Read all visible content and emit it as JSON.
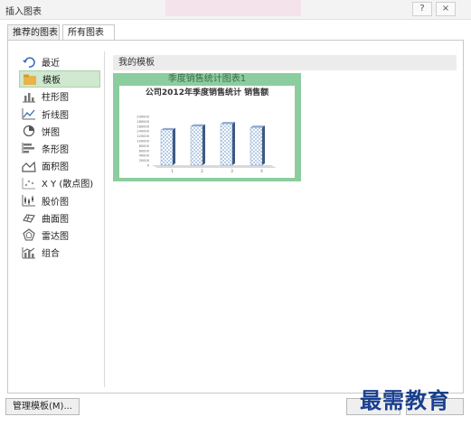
{
  "window": {
    "title": "插入图表",
    "help": "?",
    "close": "×"
  },
  "tabs": [
    {
      "label": "推荐的图表",
      "active": false
    },
    {
      "label": "所有图表",
      "active": true
    }
  ],
  "categories": [
    {
      "label": "最近",
      "icon": "recent-icon"
    },
    {
      "label": "模板",
      "icon": "folder-icon",
      "selected": true
    },
    {
      "label": "柱形图",
      "icon": "column-chart-icon"
    },
    {
      "label": "折线图",
      "icon": "line-chart-icon"
    },
    {
      "label": "饼图",
      "icon": "pie-chart-icon"
    },
    {
      "label": "条形图",
      "icon": "bar-chart-icon"
    },
    {
      "label": "面积图",
      "icon": "area-chart-icon"
    },
    {
      "label": "X Y (散点图)",
      "icon": "scatter-chart-icon"
    },
    {
      "label": "股价图",
      "icon": "stock-chart-icon"
    },
    {
      "label": "曲面图",
      "icon": "surface-chart-icon"
    },
    {
      "label": "雷达图",
      "icon": "radar-chart-icon"
    },
    {
      "label": "组合",
      "icon": "combo-chart-icon"
    }
  ],
  "templates": {
    "section_title": "我的模板",
    "items": [
      {
        "name": "季度销售统计图表1"
      }
    ]
  },
  "preview_chart": {
    "title": "公司2012年季度销售统计 销售额",
    "y_ticks": [
      "200000",
      "180000",
      "160000",
      "140000",
      "120000",
      "100000",
      "80000",
      "60000",
      "40000",
      "20000",
      "0"
    ],
    "categories": [
      "1",
      "2",
      "3",
      "4"
    ],
    "values": [
      145000,
      160000,
      170000,
      155000
    ],
    "ylim": [
      0,
      200000
    ],
    "bar_color": "#b7cde6"
  },
  "footer": {
    "manage_templates_label": "管理模板(M)...",
    "watermark": "最需教育"
  },
  "colors": {
    "accent_green": "#8ccd9f",
    "selected_bg": "#cfe8cf"
  }
}
